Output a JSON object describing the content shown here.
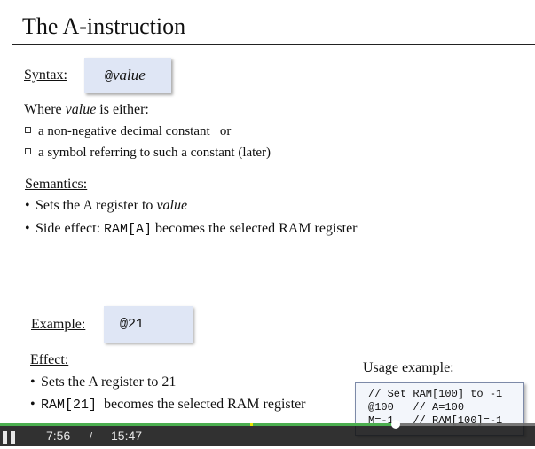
{
  "slide": {
    "title": "The A-instruction",
    "syntax": {
      "label": "Syntax:",
      "code_prefix": "@",
      "code_value": "value"
    },
    "where": {
      "prefix": "Where ",
      "italic": "value",
      "suffix": " is either:"
    },
    "options": [
      "a non-negative decimal constant   or",
      "a symbol referring to such a constant (later)"
    ],
    "semantics": {
      "label": "Semantics:",
      "bullet1_prefix": "Sets the A register to ",
      "bullet1_italic": "value",
      "bullet2_prefix": "Side effect: ",
      "bullet2_code": "RAM[A]",
      "bullet2_suffix": " becomes the selected RAM register"
    },
    "example": {
      "label": "Example:",
      "code": "@21"
    },
    "effect": {
      "label": "Effect:",
      "bullet1": "Sets the A register to 21",
      "bullet2_code": "RAM[21]",
      "bullet2_suffix": "  becomes the selected RAM register"
    },
    "usage": {
      "label": "Usage example:",
      "lines": [
        "// Set RAM[100] to -1",
        "@100   // A=100",
        "M=-1   // RAM[100]=-1"
      ]
    }
  },
  "player": {
    "current_time": "7:56",
    "separator": "/",
    "duration": "15:47",
    "progress_fraction": 0.74,
    "progress_color": "#4caf50"
  }
}
